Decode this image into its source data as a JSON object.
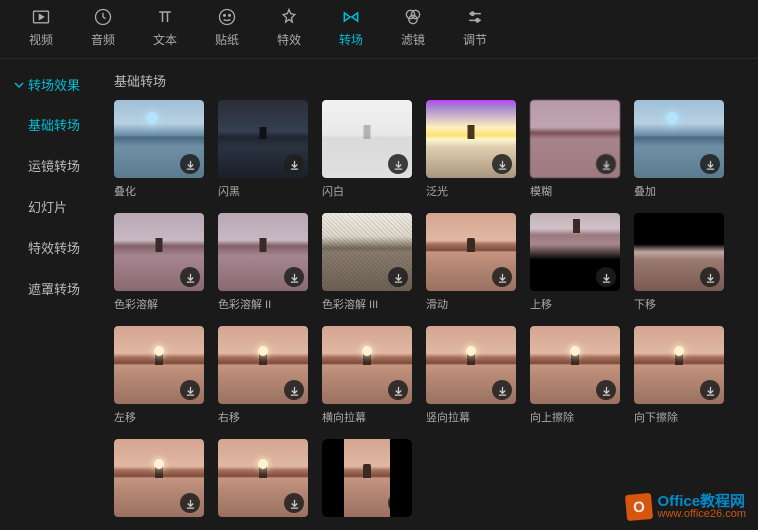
{
  "top_tabs": [
    {
      "label": "视频",
      "icon": "video-icon"
    },
    {
      "label": "音频",
      "icon": "audio-icon"
    },
    {
      "label": "文本",
      "icon": "text-icon"
    },
    {
      "label": "贴纸",
      "icon": "sticker-icon"
    },
    {
      "label": "特效",
      "icon": "effect-icon"
    },
    {
      "label": "转场",
      "icon": "transition-icon",
      "active": true
    },
    {
      "label": "滤镜",
      "icon": "filter-icon"
    },
    {
      "label": "调节",
      "icon": "adjust-icon"
    }
  ],
  "sidebar": {
    "header": "转场效果",
    "items": [
      {
        "label": "基础转场",
        "active": true
      },
      {
        "label": "运镜转场"
      },
      {
        "label": "幻灯片"
      },
      {
        "label": "特效转场"
      },
      {
        "label": "遮罩转场"
      }
    ]
  },
  "section_title": "基础转场",
  "cards": [
    {
      "label": "叠化",
      "style": "thumb-blue"
    },
    {
      "label": "闪黑",
      "style": "thumb-dark"
    },
    {
      "label": "闪白",
      "style": "thumb-white"
    },
    {
      "label": "泛光",
      "style": "thumb-glow"
    },
    {
      "label": "模糊",
      "style": "thumb-blur"
    },
    {
      "label": "叠加",
      "style": "thumb-blue"
    },
    {
      "label": "色彩溶解",
      "style": "thumb-dissolve2"
    },
    {
      "label": "色彩溶解 II",
      "style": "thumb-dissolve2"
    },
    {
      "label": "色彩溶解 III",
      "style": "thumb-noise"
    },
    {
      "label": "滑动",
      "style": "thumb-sunset"
    },
    {
      "label": "上移",
      "style": "thumb-up"
    },
    {
      "label": "下移",
      "style": "thumb-down"
    },
    {
      "label": "左移",
      "style": "thumb-sunset thumb-sunset-sun"
    },
    {
      "label": "右移",
      "style": "thumb-sunset thumb-sunset-sun"
    },
    {
      "label": "横向拉幕",
      "style": "thumb-sunset thumb-sunset-sun"
    },
    {
      "label": "竖向拉幕",
      "style": "thumb-sunset thumb-sunset-sun"
    },
    {
      "label": "向上擦除",
      "style": "thumb-sunset thumb-sunset-sun"
    },
    {
      "label": "向下擦除",
      "style": "thumb-sunset thumb-sunset-sun"
    },
    {
      "label": "",
      "style": "thumb-sunset thumb-sunset-sun"
    },
    {
      "label": "",
      "style": "thumb-sunset thumb-sunset-sun"
    },
    {
      "label": "",
      "style": "thumb-sunset thumb-squeeze"
    }
  ],
  "watermark": {
    "title": "Office教程网",
    "url": "www.office26.com"
  }
}
